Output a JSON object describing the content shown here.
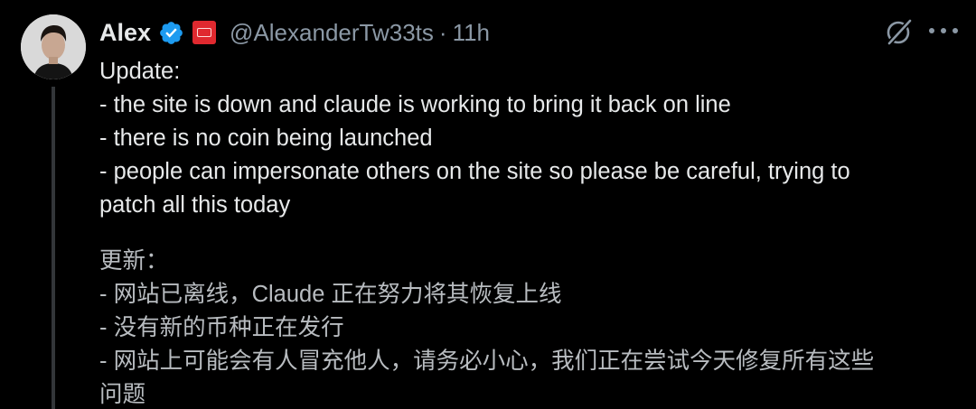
{
  "author": {
    "name": "Alex",
    "handle": "@AlexanderTw33ts",
    "separator": "·",
    "time": "11h",
    "verified_icon": "verified-badge-icon",
    "affiliation_icon": "affiliation-badge-icon"
  },
  "actions": {
    "grok_icon": "grok-icon",
    "more_icon": "more-dots-icon"
  },
  "tweet": {
    "lines": [
      "Update:",
      "- the site is down and claude is working to bring it back on line",
      "- there is no coin being launched",
      "- people can impersonate others on the site so please be careful, trying to",
      "patch all this today"
    ],
    "translation_lines": [
      "更新：",
      "- 网站已离线，Claude 正在努力将其恢复上线",
      "- 没有新的币种正在发行",
      "- 网站上可能会有人冒充他人，请务必小心，我们正在尝试今天修复所有这些",
      "问题"
    ]
  },
  "colors": {
    "background": "#000000",
    "primary_text": "#e7e9ea",
    "secondary_text": "#8b98a5",
    "verified_blue": "#1d9bf0",
    "affiliation_red": "#e0292f"
  }
}
